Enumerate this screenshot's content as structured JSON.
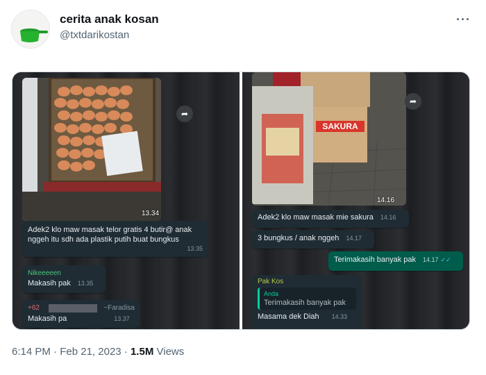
{
  "tweet": {
    "display_name": "cerita anak kosan",
    "handle": "@txtdarikostan",
    "more_icon": "more-horizontal-icon",
    "time": "6:14 PM",
    "sep1": "·",
    "date": "Feb 21, 2023",
    "sep2": "·",
    "views_count": "1.5M",
    "views_label": "Views"
  },
  "left_chat": {
    "photo_time": "13.34",
    "msg1": {
      "text": "Adek2 klo maw masak telor gratis 4 butir@ anak nggeh itu sdh ada plastik putih buat bungkus",
      "time": "13.35"
    },
    "msg2": {
      "sender": "Nikeeeeen",
      "text": "Makasih pak",
      "time": "13.35"
    },
    "msg3": {
      "sender": "+62",
      "alias": "~Faradisa",
      "text": "Makasih pa",
      "time": "13.37"
    }
  },
  "right_chat": {
    "photo_time": "14.16",
    "msg1": {
      "text": "Adek2 klo maw masak mie sakura",
      "time": "14.16"
    },
    "msg2": {
      "text": "3 bungkus / anak nggeh",
      "time": "14.17"
    },
    "msg3": {
      "text": "Terimakasih banyak pak",
      "time": "14.17",
      "ticks": "✓✓"
    },
    "msg4": {
      "sender": "Pak Kos",
      "quote_name": "Anda",
      "quote_text": "Terimakasih banyak pak",
      "text": "Masama dek Diah",
      "time": "14.33"
    },
    "box_brand": "SAKURA"
  },
  "colors": {
    "incoming_bubble": "#1f2c34",
    "outgoing_bubble": "#005c4b",
    "sender_green": "#4fc37a",
    "sender_red": "#e06a6a",
    "sender_olive": "#b8c94a"
  }
}
